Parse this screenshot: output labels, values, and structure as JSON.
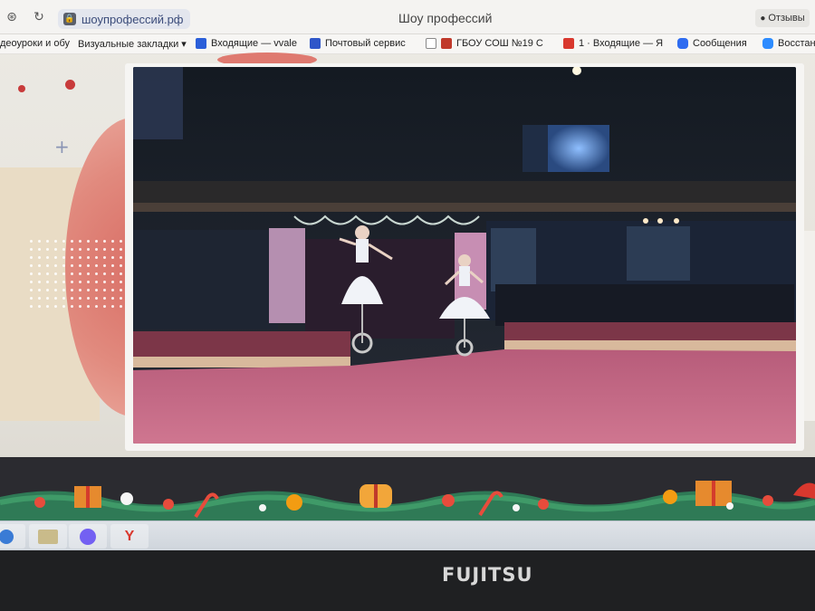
{
  "browser": {
    "address": "шоупрофессий.рф",
    "page_title": "Шоу профессий",
    "reviews_label": "Отзывы"
  },
  "bookmarks": [
    {
      "label": "деоуроки и обу",
      "icon": "none"
    },
    {
      "label": "Визуальные закладки ▾",
      "icon": "none"
    },
    {
      "label": "Входящие — vvale",
      "icon": "mail-window-icon",
      "color": "#2b5fd9"
    },
    {
      "label": "Почтовый сервис",
      "icon": "envelope-icon",
      "color": "#2f57c9"
    },
    {
      "label": "ГБОУ СОШ №19 С",
      "icon": "document-icon",
      "color": "#ffffff"
    },
    {
      "label": "1 · Входящие — Я",
      "icon": "envelope-icon",
      "color": "#d9382e"
    },
    {
      "label": "Сообщения",
      "icon": "chat-icon",
      "color": "#2f6cf0"
    },
    {
      "label": "Восстан",
      "icon": "zoom-icon",
      "color": "#2d8cff"
    }
  ],
  "video": {
    "scene": "circus-arena-unicycle-performers"
  },
  "taskbar": {
    "items": [
      "start-icon",
      "explorer-icon",
      "viber-icon",
      "yandex-browser-icon"
    ],
    "yandex_letter": "Y"
  },
  "laptop": {
    "brand": "FUJITSU"
  },
  "colors": {
    "accent_red": "#c83b3b",
    "arena_floor": "#c46a85",
    "garland_green": "#2f7a56"
  }
}
